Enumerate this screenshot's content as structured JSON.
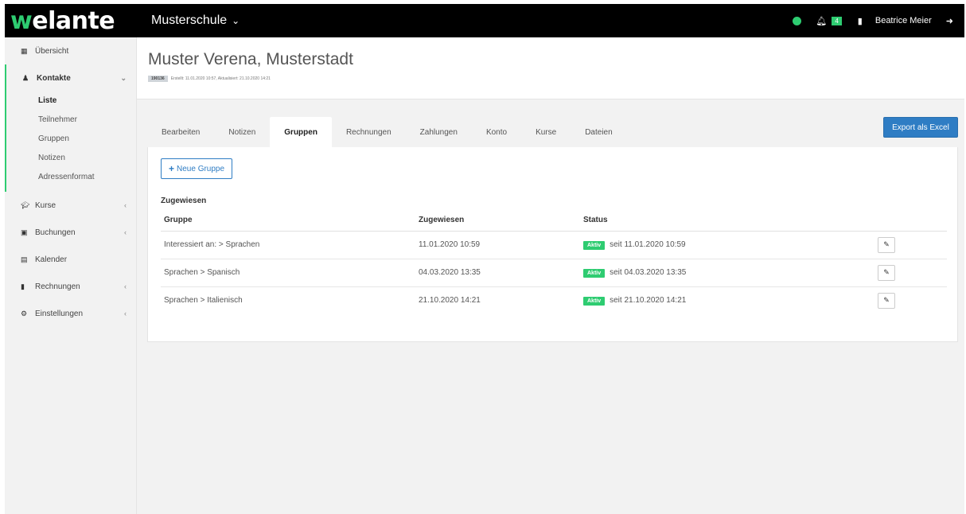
{
  "header": {
    "brand_prefix": "w",
    "brand_rest": "elante",
    "school_name": "Musterschule",
    "notification_count": "4",
    "user_name": "Beatrice Meier"
  },
  "sidebar": {
    "items": [
      {
        "label": "Übersicht",
        "icon": "grid-icon"
      },
      {
        "label": "Kontakte",
        "icon": "user-icon"
      },
      {
        "label": "Kurse",
        "icon": "graduation-cap-icon"
      },
      {
        "label": "Buchungen",
        "icon": "calendar-check-icon"
      },
      {
        "label": "Kalender",
        "icon": "calendar-icon"
      },
      {
        "label": "Rechnungen",
        "icon": "file-icon"
      },
      {
        "label": "Einstellungen",
        "icon": "cogs-icon"
      }
    ],
    "kontakte_sub": [
      "Liste",
      "Teilnehmer",
      "Gruppen",
      "Notizen",
      "Adressenformat"
    ]
  },
  "page": {
    "title": "Muster Verena, Musterstadt",
    "id": "190136",
    "meta": "Erstellt: 11.01.2020 10:57, Aktualisiert: 21.10.2020 14:21"
  },
  "tabs": [
    "Bearbeiten",
    "Notizen",
    "Gruppen",
    "Rechnungen",
    "Zahlungen",
    "Konto",
    "Kurse",
    "Dateien"
  ],
  "export_label": "Export als Excel",
  "new_group_label": "Neue Gruppe",
  "section_title": "Zugewiesen",
  "table": {
    "headers": [
      "Gruppe",
      "Zugewiesen",
      "Status"
    ],
    "rows": [
      {
        "gruppe": "Interessiert an: > Sprachen",
        "zugewiesen": "11.01.2020 10:59",
        "status_badge": "Aktiv",
        "status_text": "seit 11.01.2020 10:59"
      },
      {
        "gruppe": "Sprachen > Spanisch",
        "zugewiesen": "04.03.2020 13:35",
        "status_badge": "Aktiv",
        "status_text": "seit 04.03.2020 13:35"
      },
      {
        "gruppe": "Sprachen > Italienisch",
        "zugewiesen": "21.10.2020 14:21",
        "status_badge": "Aktiv",
        "status_text": "seit 21.10.2020 14:21"
      }
    ]
  },
  "colors": {
    "accent_green": "#2ecc71",
    "primary_blue": "#2f7dc4"
  }
}
